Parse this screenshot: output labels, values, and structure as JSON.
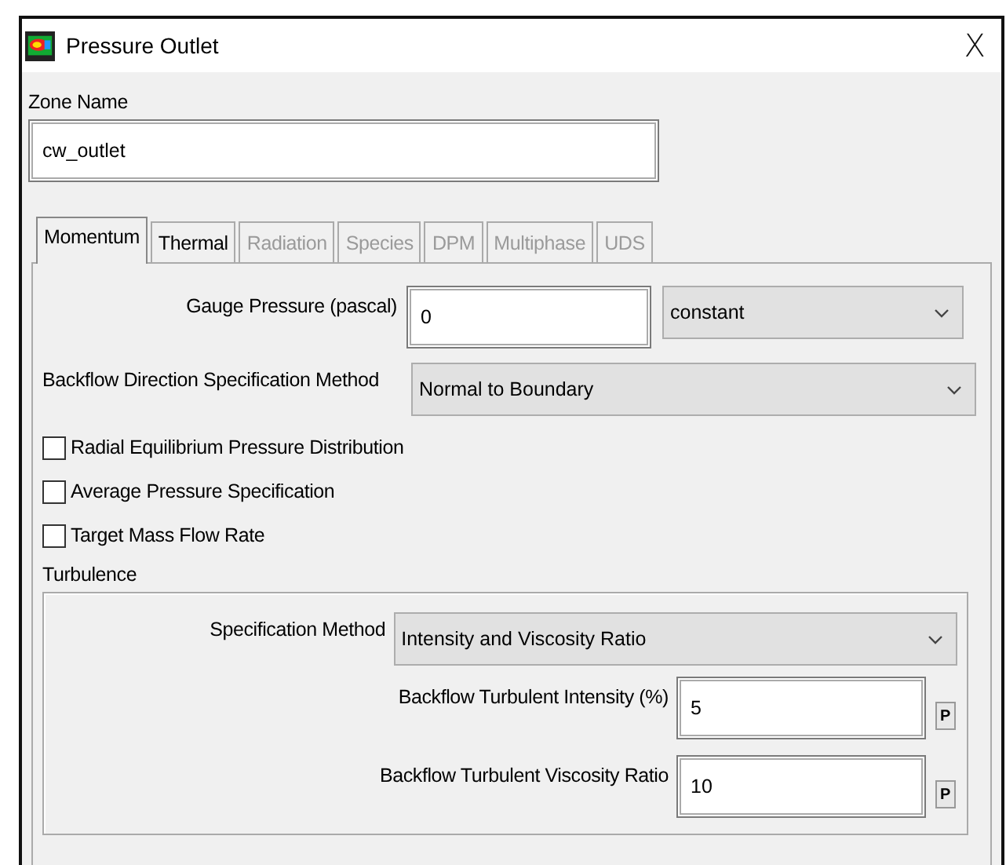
{
  "window": {
    "title": "Pressure Outlet",
    "close": "X"
  },
  "zone_name": {
    "label": "Zone Name",
    "value": "cw_outlet"
  },
  "tabs": [
    {
      "label": "Momentum",
      "selected": true,
      "disabled": false
    },
    {
      "label": "Thermal",
      "selected": false,
      "disabled": false
    },
    {
      "label": "Radiation",
      "selected": false,
      "disabled": true
    },
    {
      "label": "Species",
      "selected": false,
      "disabled": true
    },
    {
      "label": "DPM",
      "selected": false,
      "disabled": true
    },
    {
      "label": "Multiphase",
      "selected": false,
      "disabled": true
    },
    {
      "label": "UDS",
      "selected": false,
      "disabled": true
    }
  ],
  "gauge_pressure": {
    "label": "Gauge Pressure (pascal)",
    "value": "0",
    "method": "constant"
  },
  "backflow_direction": {
    "label": "Backflow Direction Specification Method",
    "value": "Normal to Boundary"
  },
  "options": [
    {
      "label": "Radial Equilibrium Pressure Distribution",
      "checked": false
    },
    {
      "label": "Average Pressure Specification",
      "checked": false
    },
    {
      "label": "Target Mass Flow Rate",
      "checked": false
    }
  ],
  "turbulence": {
    "title": "Turbulence",
    "method_label": "Specification Method",
    "method": "Intensity and Viscosity Ratio",
    "fields": [
      {
        "label": "Backflow Turbulent Intensity (%)",
        "value": "5",
        "param": "P"
      },
      {
        "label": "Backflow Turbulent Viscosity Ratio",
        "value": "10",
        "param": "P"
      }
    ]
  }
}
